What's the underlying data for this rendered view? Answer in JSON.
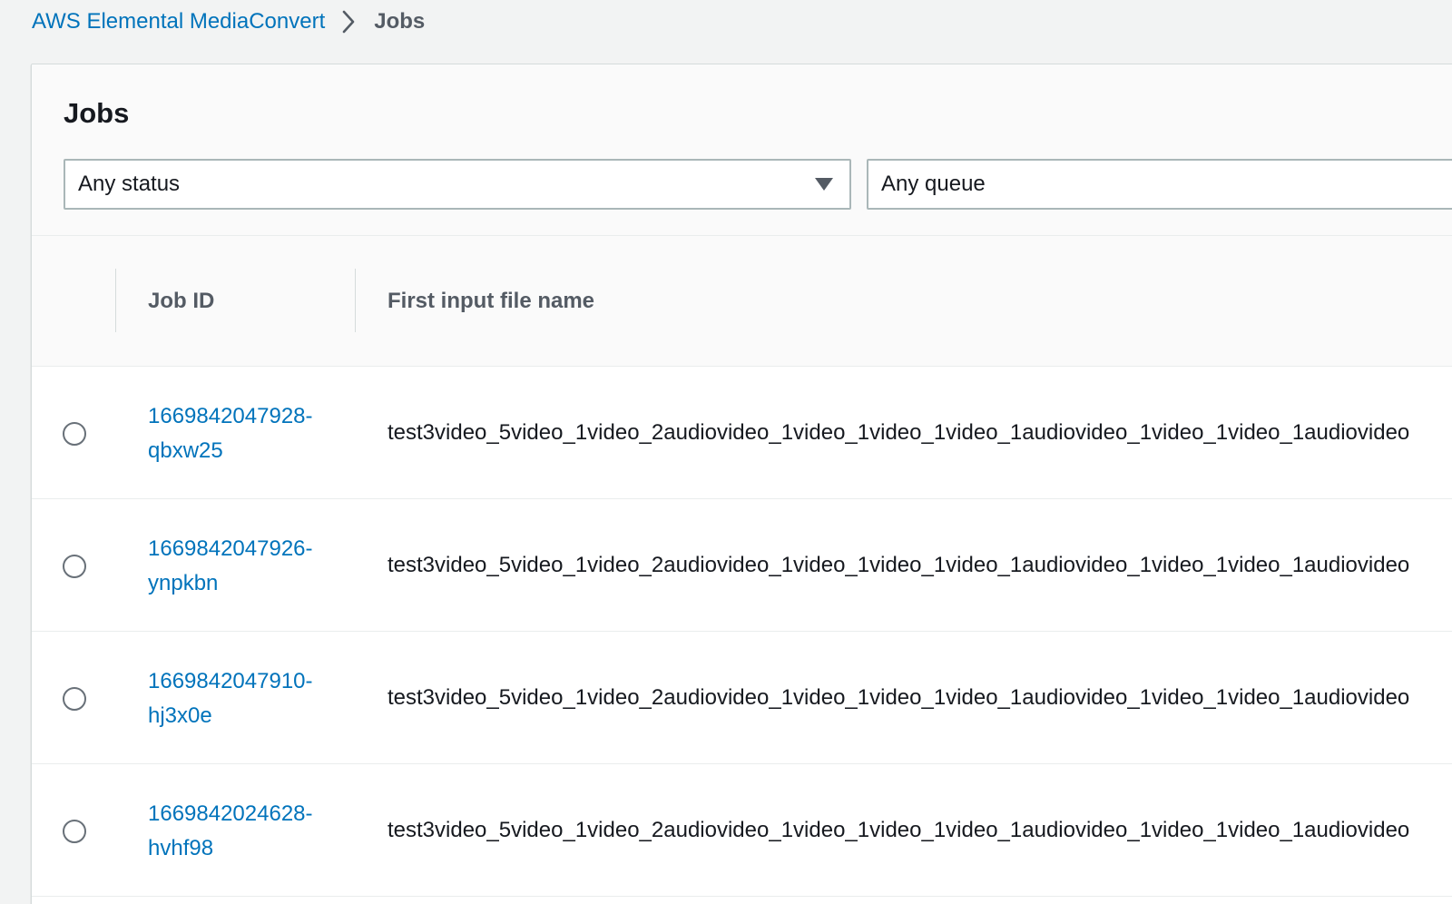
{
  "breadcrumb": {
    "service": "AWS Elemental MediaConvert",
    "current": "Jobs"
  },
  "panel": {
    "title": "Jobs",
    "filters": {
      "status": "Any status",
      "queue": "Any queue"
    }
  },
  "table": {
    "columns": {
      "job_id": "Job ID",
      "first_input": "First input file name"
    },
    "rows": [
      {
        "job_id_line1": "1669842047928-",
        "job_id_line2": "qbxw25",
        "file": "test3video_5video_1video_2audiovideo_1video_1video_1video_1audiovideo_1video_1video_1audiovideo"
      },
      {
        "job_id_line1": "1669842047926-",
        "job_id_line2": "ynpkbn",
        "file": "test3video_5video_1video_2audiovideo_1video_1video_1video_1audiovideo_1video_1video_1audiovideo"
      },
      {
        "job_id_line1": "1669842047910-",
        "job_id_line2": "hj3x0e",
        "file": "test3video_5video_1video_2audiovideo_1video_1video_1video_1audiovideo_1video_1video_1audiovideo"
      },
      {
        "job_id_line1": "1669842024628-",
        "job_id_line2": "hvhf98",
        "file": "test3video_5video_1video_2audiovideo_1video_1video_1video_1audiovideo_1video_1video_1audiovideo"
      }
    ]
  }
}
